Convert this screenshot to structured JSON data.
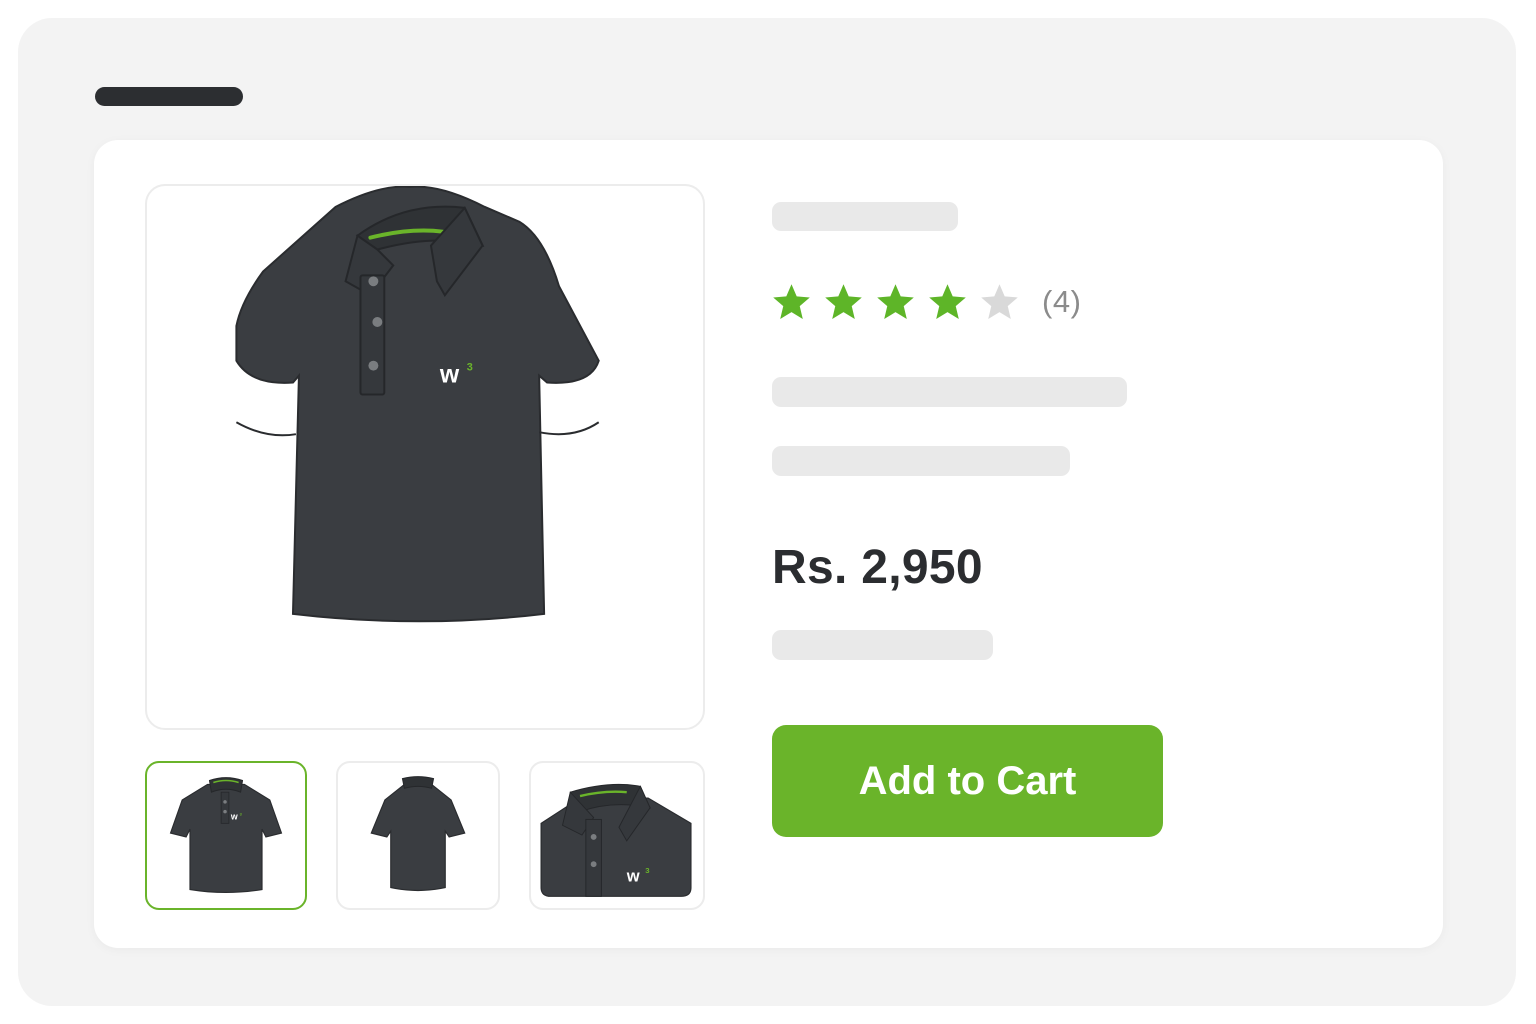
{
  "colors": {
    "accent": "#6ab42a",
    "shirt": "#3a3d41",
    "star_filled": "#5eb528",
    "star_empty": "#d9d9d9"
  },
  "gallery": {
    "main_image": {
      "icon": "polo-shirt-front-image",
      "logo_text": "w",
      "logo_sup": "3"
    },
    "thumbnails": [
      {
        "icon": "polo-shirt-front-thumbnail",
        "selected": true,
        "logo_text": "w",
        "logo_sup": "3"
      },
      {
        "icon": "polo-shirt-back-thumbnail",
        "selected": false
      },
      {
        "icon": "polo-shirt-collar-closeup-thumbnail",
        "selected": false,
        "logo_text": "w",
        "logo_sup": "3"
      }
    ]
  },
  "product": {
    "rating": {
      "value": 4,
      "max": 5,
      "count_label": "(4)"
    },
    "price": "Rs. 2,950",
    "add_to_cart_label": "Add to Cart"
  }
}
